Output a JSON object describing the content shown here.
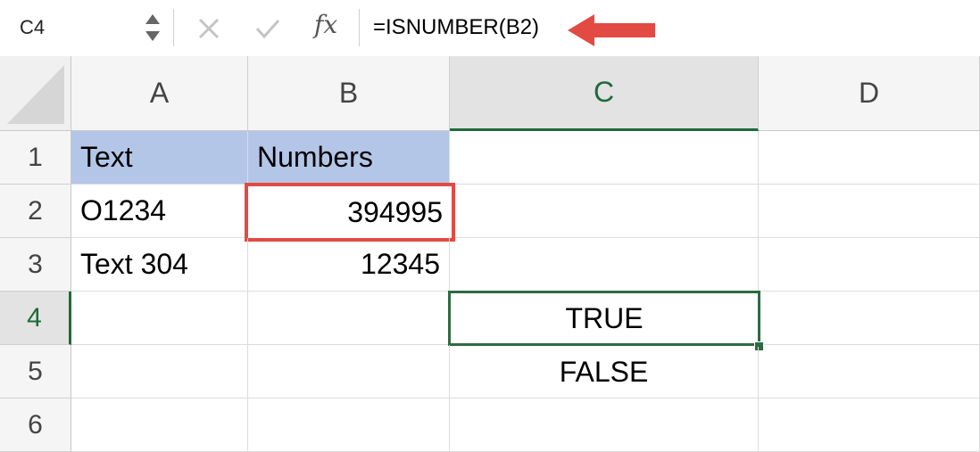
{
  "formula_bar": {
    "name_box": "C4",
    "fx_label": "fx",
    "formula": "=ISNUMBER(B2)"
  },
  "columns": [
    "A",
    "B",
    "C",
    "D"
  ],
  "rows": [
    "1",
    "2",
    "3",
    "4",
    "5",
    "6"
  ],
  "cells": {
    "A1": "Text",
    "B1": "Numbers",
    "A2": "O1234",
    "B2": "394995",
    "A3": "Text 304",
    "B3": "12345",
    "C4": "TRUE",
    "C5": "FALSE"
  },
  "selection": {
    "active_cell": "C4",
    "active_column": "C",
    "active_row": "4"
  },
  "colors": {
    "header_fill": "#b4c6e7",
    "annotation_red": "#e34a43",
    "selection_green": "#2e6b40"
  },
  "icons": {
    "stepper": "up-down-stepper-icon",
    "cancel": "x-icon",
    "confirm": "checkmark-icon",
    "function": "fx-icon",
    "annotation": "left-arrow-icon"
  }
}
